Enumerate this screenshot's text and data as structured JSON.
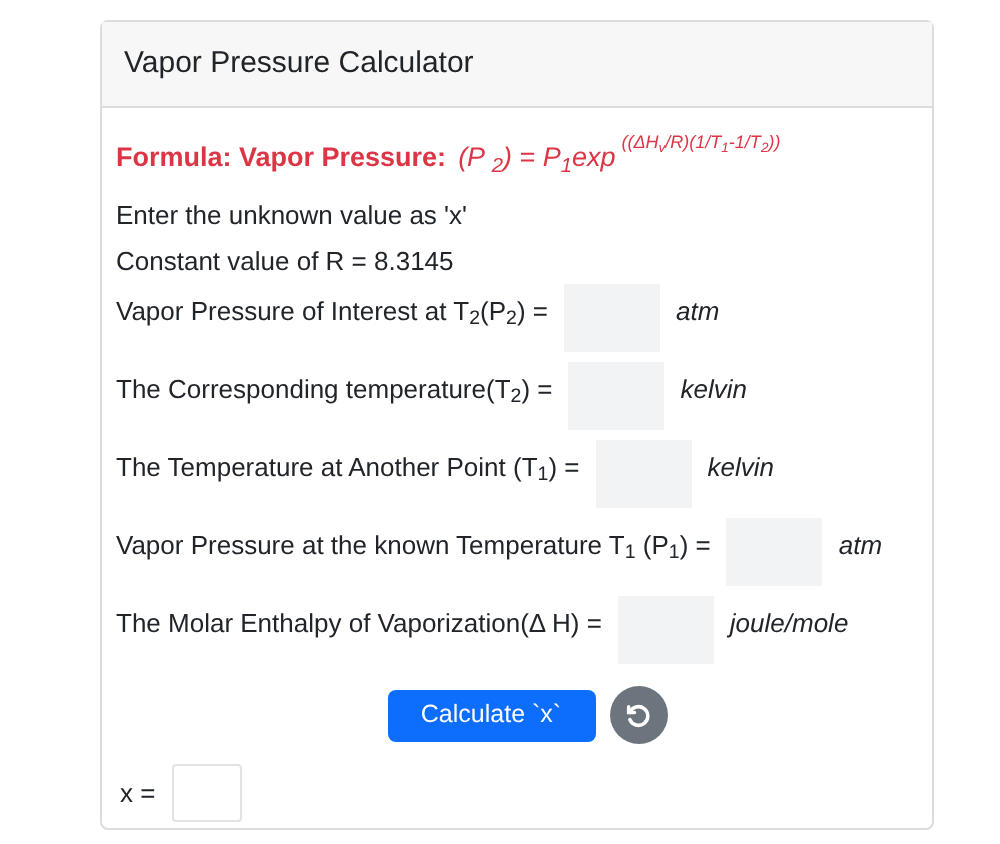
{
  "title": "Vapor Pressure Calculator",
  "formula": {
    "label": "Formula: Vapor Pressure:",
    "expression": "(P $_{2}$) = P$_{1}$exp",
    "exponent": "((ΔH$_{v}$/R)(1/T$_{1}$-1/T$_{2}$))"
  },
  "notes": [
    "Enter the unknown value as 'x'",
    "Constant value of R = 8.3145"
  ],
  "fields": [
    {
      "label": "Vapor Pressure of Interest at T$_{2}$(P$_{2}$) =",
      "unit": "atm"
    },
    {
      "label": "The Corresponding temperature(T$_{2}$) =",
      "unit": "kelvin"
    },
    {
      "label": "The Temperature at Another Point (T$_{1}$) =",
      "unit": "kelvin"
    },
    {
      "label": "Vapor Pressure at the known Temperature T$_{1}$ (P$_{1}$) =",
      "unit": "atm"
    },
    {
      "label": "The Molar Enthalpy of Vaporization(Δ H) =",
      "unit": "joule/mole"
    }
  ],
  "calculate_button": "Calculate `x`",
  "result": {
    "label": "x ="
  }
}
